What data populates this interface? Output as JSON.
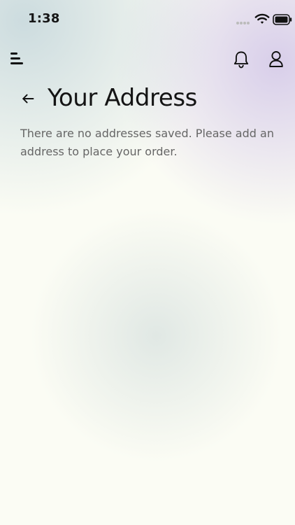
{
  "status_bar": {
    "time": "1:38",
    "icons": {
      "signal": "signal-icon",
      "wifi": "wifi-icon",
      "battery": "battery-icon"
    }
  },
  "topbar": {
    "icons": {
      "menu": "menu-icon",
      "notifications": "bell-icon",
      "profile": "person-icon"
    }
  },
  "page": {
    "title": "Your Address",
    "message": "There are no addresses saved. Please add an address to place your order.",
    "icons": {
      "back": "arrow-left-icon"
    }
  },
  "colors": {
    "background": "#fbfcf4",
    "text": "#161616",
    "muted_text": "#666666"
  }
}
